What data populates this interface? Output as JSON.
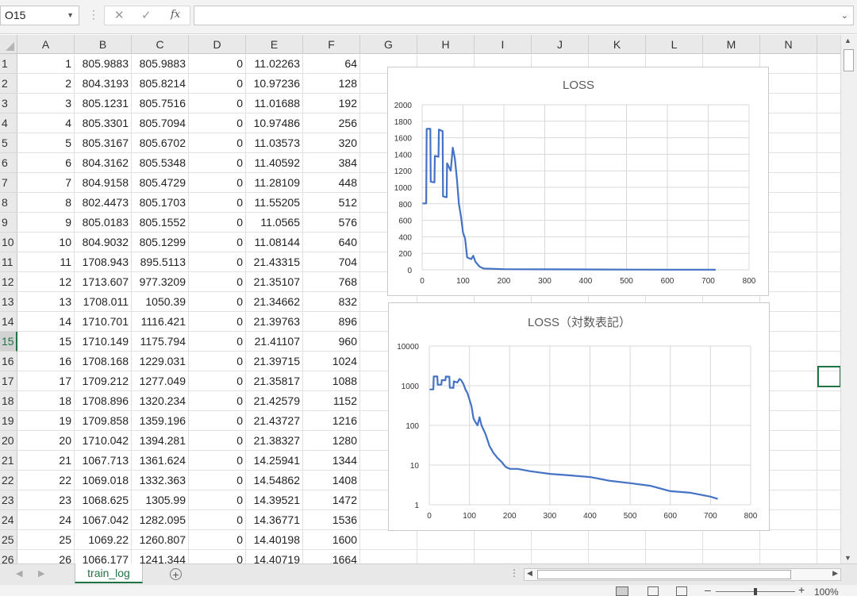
{
  "formula_bar": {
    "name_box": "O15",
    "formula_value": ""
  },
  "columns": [
    "A",
    "B",
    "C",
    "D",
    "E",
    "F",
    "G",
    "H",
    "I",
    "J",
    "K",
    "L",
    "M",
    "N"
  ],
  "active_row": "15",
  "rows": [
    {
      "r": "1",
      "a": "1",
      "b": "805.9883",
      "c": "805.9883",
      "d": "0",
      "e": "11.02263",
      "f": "64"
    },
    {
      "r": "2",
      "a": "2",
      "b": "804.3193",
      "c": "805.8214",
      "d": "0",
      "e": "10.97236",
      "f": "128"
    },
    {
      "r": "3",
      "a": "3",
      "b": "805.1231",
      "c": "805.7516",
      "d": "0",
      "e": "11.01688",
      "f": "192"
    },
    {
      "r": "4",
      "a": "4",
      "b": "805.3301",
      "c": "805.7094",
      "d": "0",
      "e": "10.97486",
      "f": "256"
    },
    {
      "r": "5",
      "a": "5",
      "b": "805.3167",
      "c": "805.6702",
      "d": "0",
      "e": "11.03573",
      "f": "320"
    },
    {
      "r": "6",
      "a": "6",
      "b": "804.3162",
      "c": "805.5348",
      "d": "0",
      "e": "11.40592",
      "f": "384"
    },
    {
      "r": "7",
      "a": "7",
      "b": "804.9158",
      "c": "805.4729",
      "d": "0",
      "e": "11.28109",
      "f": "448"
    },
    {
      "r": "8",
      "a": "8",
      "b": "802.4473",
      "c": "805.1703",
      "d": "0",
      "e": "11.55205",
      "f": "512"
    },
    {
      "r": "9",
      "a": "9",
      "b": "805.0183",
      "c": "805.1552",
      "d": "0",
      "e": "11.0565",
      "f": "576"
    },
    {
      "r": "10",
      "a": "10",
      "b": "804.9032",
      "c": "805.1299",
      "d": "0",
      "e": "11.08144",
      "f": "640"
    },
    {
      "r": "11",
      "a": "11",
      "b": "1708.943",
      "c": "895.5113",
      "d": "0",
      "e": "21.43315",
      "f": "704"
    },
    {
      "r": "12",
      "a": "12",
      "b": "1713.607",
      "c": "977.3209",
      "d": "0",
      "e": "21.35107",
      "f": "768"
    },
    {
      "r": "13",
      "a": "13",
      "b": "1708.011",
      "c": "1050.39",
      "d": "0",
      "e": "21.34662",
      "f": "832"
    },
    {
      "r": "14",
      "a": "14",
      "b": "1710.701",
      "c": "1116.421",
      "d": "0",
      "e": "21.39763",
      "f": "896"
    },
    {
      "r": "15",
      "a": "15",
      "b": "1710.149",
      "c": "1175.794",
      "d": "0",
      "e": "21.41107",
      "f": "960"
    },
    {
      "r": "16",
      "a": "16",
      "b": "1708.168",
      "c": "1229.031",
      "d": "0",
      "e": "21.39715",
      "f": "1024"
    },
    {
      "r": "17",
      "a": "17",
      "b": "1709.212",
      "c": "1277.049",
      "d": "0",
      "e": "21.35817",
      "f": "1088"
    },
    {
      "r": "18",
      "a": "18",
      "b": "1708.896",
      "c": "1320.234",
      "d": "0",
      "e": "21.42579",
      "f": "1152"
    },
    {
      "r": "19",
      "a": "19",
      "b": "1709.858",
      "c": "1359.196",
      "d": "0",
      "e": "21.43727",
      "f": "1216"
    },
    {
      "r": "20",
      "a": "20",
      "b": "1710.042",
      "c": "1394.281",
      "d": "0",
      "e": "21.38327",
      "f": "1280"
    },
    {
      "r": "21",
      "a": "21",
      "b": "1067.713",
      "c": "1361.624",
      "d": "0",
      "e": "14.25941",
      "f": "1344"
    },
    {
      "r": "22",
      "a": "22",
      "b": "1069.018",
      "c": "1332.363",
      "d": "0",
      "e": "14.54862",
      "f": "1408"
    },
    {
      "r": "23",
      "a": "23",
      "b": "1068.625",
      "c": "1305.99",
      "d": "0",
      "e": "14.39521",
      "f": "1472"
    },
    {
      "r": "24",
      "a": "24",
      "b": "1067.042",
      "c": "1282.095",
      "d": "0",
      "e": "14.36771",
      "f": "1536"
    },
    {
      "r": "25",
      "a": "25",
      "b": "1069.22",
      "c": "1260.807",
      "d": "0",
      "e": "14.40198",
      "f": "1600"
    },
    {
      "r": "26",
      "a": "26",
      "b": "1066.177",
      "c": "1241.344",
      "d": "0",
      "e": "14.40719",
      "f": "1664"
    }
  ],
  "sheet_tab": "train_log",
  "zoom_level": "100%",
  "colors": {
    "accent": "#217346",
    "series": "#4472c4"
  },
  "chart_data": [
    {
      "type": "line",
      "title": "LOSS",
      "xlim": [
        0,
        800
      ],
      "ylim": [
        0,
        2000
      ],
      "x_ticks": [
        0,
        100,
        200,
        300,
        400,
        500,
        600,
        700,
        800
      ],
      "y_ticks": [
        0,
        200,
        400,
        600,
        800,
        1000,
        1200,
        1400,
        1600,
        1800,
        2000
      ],
      "grid": true,
      "series": [
        {
          "x": [
            1,
            10,
            11,
            20,
            21,
            30,
            31,
            40,
            41,
            50,
            51,
            60,
            61,
            65,
            70,
            75,
            80,
            85,
            90,
            95,
            100,
            105,
            110,
            115,
            120,
            125,
            130,
            140,
            150,
            200,
            300,
            400,
            500,
            600,
            700,
            718
          ],
          "values": [
            805,
            805,
            1709,
            1710,
            1068,
            1060,
            1380,
            1370,
            1700,
            1680,
            890,
            880,
            1290,
            1250,
            1200,
            1480,
            1350,
            1100,
            800,
            650,
            450,
            380,
            150,
            140,
            130,
            170,
            100,
            40,
            15,
            8,
            6,
            5,
            3,
            2,
            1.5,
            1.3
          ]
        }
      ]
    },
    {
      "type": "line",
      "title": "LOSS（対数表記）",
      "y_scale": "log",
      "xlim": [
        0,
        800
      ],
      "ylim": [
        1,
        10000
      ],
      "x_ticks": [
        0,
        100,
        200,
        300,
        400,
        500,
        600,
        700,
        800
      ],
      "y_ticks": [
        1,
        10,
        100,
        1000,
        10000
      ],
      "grid": true,
      "series": [
        {
          "x": [
            1,
            10,
            11,
            20,
            21,
            30,
            31,
            40,
            41,
            50,
            51,
            60,
            61,
            65,
            70,
            75,
            80,
            85,
            90,
            95,
            100,
            105,
            110,
            115,
            120,
            125,
            130,
            140,
            150,
            160,
            170,
            180,
            190,
            200,
            220,
            250,
            300,
            350,
            400,
            450,
            500,
            550,
            600,
            650,
            700,
            718
          ],
          "values": [
            805,
            805,
            1709,
            1710,
            1068,
            1060,
            1380,
            1370,
            1700,
            1680,
            890,
            880,
            1290,
            1250,
            1200,
            1480,
            1350,
            1100,
            800,
            650,
            450,
            300,
            150,
            120,
            100,
            160,
            100,
            60,
            30,
            20,
            15,
            12,
            9,
            8,
            8,
            7,
            6,
            5.5,
            5,
            4,
            3.5,
            3,
            2.2,
            2,
            1.6,
            1.4
          ]
        }
      ]
    }
  ]
}
